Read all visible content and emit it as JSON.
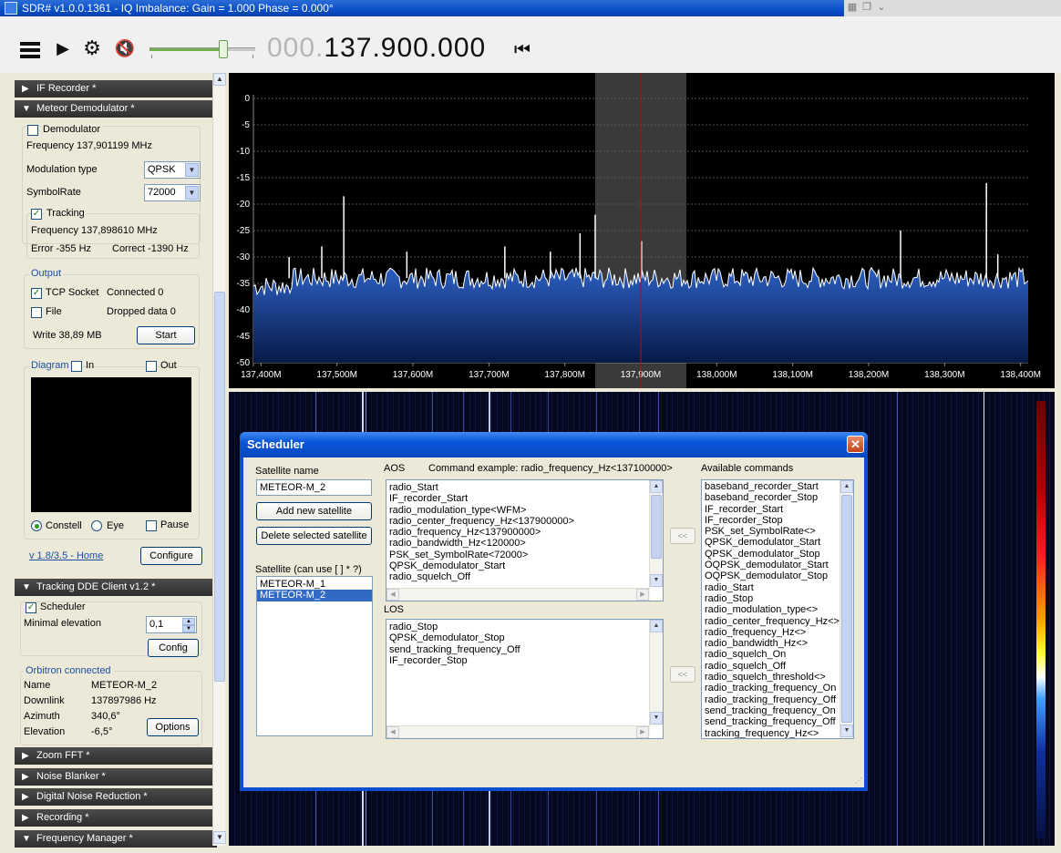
{
  "window": {
    "title": "SDR# v1.0.0.1361 - IQ Imbalance: Gain = 1.000 Phase = 0.000°"
  },
  "toolbar": {
    "frequency_dim": "000.",
    "frequency_main": "137.900.000",
    "volume_fraction": 0.7
  },
  "left": {
    "if_recorder": "IF Recorder *",
    "meteor_demodulator": "Meteor Demodulator *",
    "demodulator_label": "Demodulator",
    "frequency": "Frequency 137,901199 MHz",
    "modulation_type_label": "Modulation type",
    "modulation_type_value": "QPSK",
    "symbolrate_label": "SymbolRate",
    "symbolrate_value": "72000",
    "tracking_label": "Tracking",
    "tracking_frequency": "Frequency 137,898610 MHz",
    "error": "Error -355 Hz",
    "correct": "Correct -1390 Hz",
    "output_label": "Output",
    "tcp_socket": "TCP Socket",
    "connected": "Connected 0",
    "file_label": "File",
    "dropped": "Dropped data 0",
    "write": "Write 38,89 MB",
    "start_button": "Start",
    "diagram_label": "Diagram",
    "in_label": "In",
    "out_label": "Out",
    "constell_label": "Constell",
    "eye_label": "Eye",
    "pause_label": "Pause",
    "version_link": "v 1.8/3.5 - Home",
    "configure_button": "Configure",
    "tracking_dde": "Tracking DDE Client v1.2 *",
    "scheduler_label": "Scheduler",
    "minimal_elevation_label": "Minimal elevation",
    "minimal_elevation_value": "0,1",
    "config_button": "Config",
    "orbitron": "Orbitron connected",
    "name_label": "Name",
    "name_value": "METEOR-M_2",
    "downlink_label": "Downlink",
    "downlink_value": "137897986 Hz",
    "azimuth_label": "Azimuth",
    "azimuth_value": "340,6°",
    "elevation_label": "Elevation",
    "elevation_value": "-6,5°",
    "options_button": "Options",
    "zoom_fft": "Zoom FFT *",
    "noise_blanker": "Noise Blanker *",
    "digital_noise": "Digital Noise Reduction *",
    "recording": "Recording *",
    "frequency_manager": "Frequency Manager *"
  },
  "spectrum": {
    "y_ticks": [
      "0",
      "-5",
      "-10",
      "-15",
      "-20",
      "-25",
      "-30",
      "-35",
      "-40",
      "-45",
      "-50"
    ],
    "x_ticks": [
      "137,400M",
      "137,500M",
      "137,600M",
      "137,700M",
      "137,800M",
      "137,900M",
      "138,000M",
      "138,100M",
      "138,200M",
      "138,300M",
      "138,400M"
    ],
    "noise_floor_db": -34,
    "spikes": [
      {
        "mhz": 137.437,
        "db": -30
      },
      {
        "mhz": 137.48,
        "db": -28
      },
      {
        "mhz": 137.509,
        "db": -18.5
      },
      {
        "mhz": 137.592,
        "db": -29
      },
      {
        "mhz": 137.721,
        "db": -28
      },
      {
        "mhz": 137.781,
        "db": -29
      },
      {
        "mhz": 137.82,
        "db": -25.5
      },
      {
        "mhz": 137.84,
        "db": -22
      },
      {
        "mhz": 137.901,
        "db": -27
      },
      {
        "mhz": 138.242,
        "db": -25
      },
      {
        "mhz": 138.355,
        "db": -16
      },
      {
        "mhz": 138.37,
        "db": -29.5
      }
    ],
    "filter_center_mhz": 137.9,
    "filter_width_mhz": 0.12,
    "x_range_mhz": [
      137.39,
      138.41
    ],
    "y_range_db": [
      -50,
      0
    ]
  },
  "scheduler": {
    "title": "Scheduler",
    "satellite_name_label": "Satellite name",
    "satellite_name_value": "METEOR-M_2",
    "add_button": "Add new satellite",
    "delete_button": "Delete selected satellite",
    "satellite_list_label": "Satellite (can use [ ] * ?)",
    "satellites": [
      "METEOR-M_1",
      "METEOR-M_2"
    ],
    "selected_satellite": "METEOR-M_2",
    "aos_label": "AOS",
    "command_example": "Command  example:  radio_frequency_Hz<137100000>",
    "aos_commands": [
      "radio_Start",
      "IF_recorder_Start",
      "radio_modulation_type<WFM>",
      "radio_center_frequency_Hz<137900000>",
      "radio_frequency_Hz<137900000>",
      "radio_bandwidth_Hz<120000>",
      "PSK_set_SymbolRate<72000>",
      "QPSK_demodulator_Start",
      "radio_squelch_Off"
    ],
    "los_label": "LOS",
    "los_commands": [
      "radio_Stop",
      "QPSK_demodulator_Stop",
      "send_tracking_frequency_Off",
      "IF_recorder_Stop"
    ],
    "arrow_label": "<<",
    "available_label": "Available commands",
    "available_commands": [
      "baseband_recorder_Start",
      "baseband_recorder_Stop",
      "IF_recorder_Start",
      "IF_recorder_Stop",
      "PSK_set_SymbolRate<>",
      "QPSK_demodulator_Start",
      "QPSK_demodulator_Stop",
      "OQPSK_demodulator_Start",
      "OQPSK_demodulator_Stop",
      "radio_Start",
      "radio_Stop",
      "radio_modulation_type<>",
      "radio_center_frequency_Hz<>",
      "radio_frequency_Hz<>",
      "radio_bandwidth_Hz<>",
      "radio_squelch_On",
      "radio_squelch_Off",
      "radio_squelch_threshold<>",
      "radio_tracking_frequency_On",
      "radio_tracking_frequency_Off",
      "send_tracking_frequency_On",
      "send_tracking_frequency_Off",
      "tracking_frequency_Hz<>"
    ]
  },
  "colors": {
    "accent": "#0a4fd0",
    "spectrum_fill": "#0f2f70",
    "waterfall_bg": "#06081e",
    "center_line": "#d00000"
  }
}
